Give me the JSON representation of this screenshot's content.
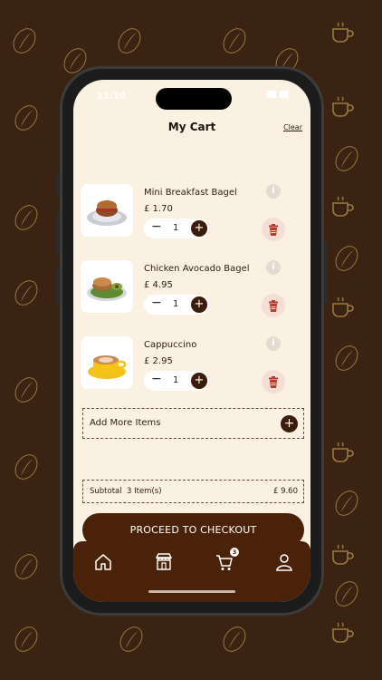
{
  "status": {
    "time": "11:10"
  },
  "header": {
    "title": "My Cart",
    "clear_label": "Clear"
  },
  "items": [
    {
      "name": "Mini Breakfast Bagel",
      "price": "£ 1.70",
      "qty": "1",
      "image_icon": "bagel-plate-icon"
    },
    {
      "name": "Chicken Avocado Bagel",
      "price": "£ 4.95",
      "qty": "1",
      "image_icon": "avocado-bagel-plate-icon"
    },
    {
      "name": "Cappuccino",
      "price": "£ 2.95",
      "qty": "1",
      "image_icon": "cappuccino-cup-icon"
    }
  ],
  "add_more": {
    "label": "Add More Items"
  },
  "summary": {
    "subtotal_label": "Subtotal",
    "item_count": "3 Item(s)",
    "subtotal_value": "£ 9.60"
  },
  "checkout": {
    "label": "PROCEED TO CHECKOUT"
  },
  "nav": {
    "cart_badge": "3",
    "icons": [
      "home-icon",
      "store-icon",
      "cart-icon",
      "profile-icon"
    ]
  },
  "colors": {
    "primary": "#4a2209",
    "background": "#fbf1e3",
    "delete_tint": "#f4dfd6",
    "delete_icon": "#c0392b",
    "pattern_bg": "#3a2312"
  }
}
